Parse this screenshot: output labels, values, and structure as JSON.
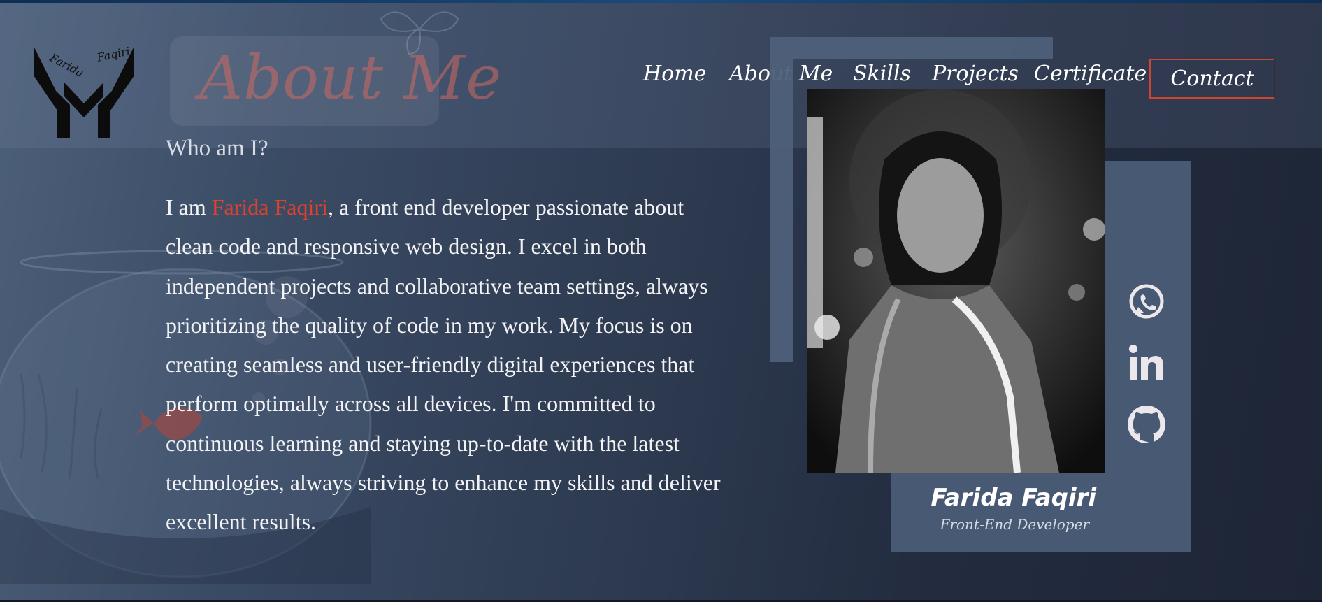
{
  "header": {
    "section_title": "About Me",
    "nav": {
      "home": "Home",
      "about": "About Me",
      "skills": "Skills",
      "projects": "Projects",
      "certificate": "Certificate",
      "contact": "Contact"
    }
  },
  "logo": {
    "text_left": "Farida",
    "text_right": "Faqiri"
  },
  "about": {
    "heading": "Who am I?",
    "bio_prefix": "I am ",
    "bio_name": "Farida Faqiri",
    "bio_rest": ", a front end developer passionate about clean code and responsive web design. I excel in both independent projects and collaborative team settings, always prioritizing the quality of code in my work. My focus is on creating seamless and user-friendly digital experiences that perform optimally across all devices. I'm committed to continuous learning and staying up-to-date with the latest technologies, always striving to enhance my skills and deliver excellent results."
  },
  "profile_card": {
    "name": "Farida Faqiri",
    "role": "Front-End Developer"
  },
  "social": [
    {
      "icon": "whatsapp-icon"
    },
    {
      "icon": "linkedin-icon"
    },
    {
      "icon": "github-icon"
    }
  ],
  "colors": {
    "accent": "#e0402c",
    "card": "#485a73",
    "icon": "#ece7ea"
  }
}
